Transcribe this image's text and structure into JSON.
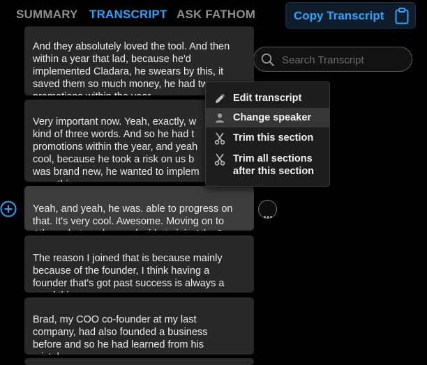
{
  "tabs": [
    {
      "label": "SUMMARY",
      "active": false
    },
    {
      "label": "TRANSCRIPT",
      "active": true
    },
    {
      "label": "ASK FATHOM",
      "active": false
    }
  ],
  "copy_button": {
    "label": "Copy Transcript",
    "icon": "clipboard-icon"
  },
  "search": {
    "placeholder": "Search Transcript",
    "icon": "search-icon"
  },
  "messages": [
    {
      "text": "And they absolutely loved the tool. And then\nwithin a year that lad, because he'd\nimplemented Cladara, he swears by this, it\nsaved them so much money, he had two\npromotions within the year."
    },
    {
      "text": "Very important now. Yeah, exactly, w\nkind of three words. And so he had t\npromotions within the year, and yeah\ncool, because he took a risk on us b\nwas brand new, he wanted to implem\nsomething new."
    },
    {
      "text": "Yeah, and yeah, he was. able to progress on\nthat. It's very cool. Awesome. Moving on to\nAtlas, what made you decide to join Atlas?"
    },
    {
      "text": "The reason I joined that is because mainly\nbecause of the founder, I think having a\nfounder that's got past success is always a\ngood thing."
    },
    {
      "text": "Brad, my COO co-founder at my last\ncompany, had also founded a business\nbefore and so he had learned from his\nmistakes."
    }
  ],
  "context_menu": {
    "items": [
      {
        "label": "Edit transcript",
        "icon": "pencil-icon"
      },
      {
        "label": "Change speaker",
        "icon": "person-icon"
      },
      {
        "label": "Trim this section",
        "icon": "scissors-icon"
      },
      {
        "label": "Trim all sections\nafter this section",
        "icon": "scissors-icon"
      }
    ]
  },
  "colors": {
    "accent": "#2aa3ff",
    "background": "#000000",
    "bubble": "#282828",
    "bubble_highlight": "#3c3c3c",
    "menu": "#1d1d1d"
  }
}
